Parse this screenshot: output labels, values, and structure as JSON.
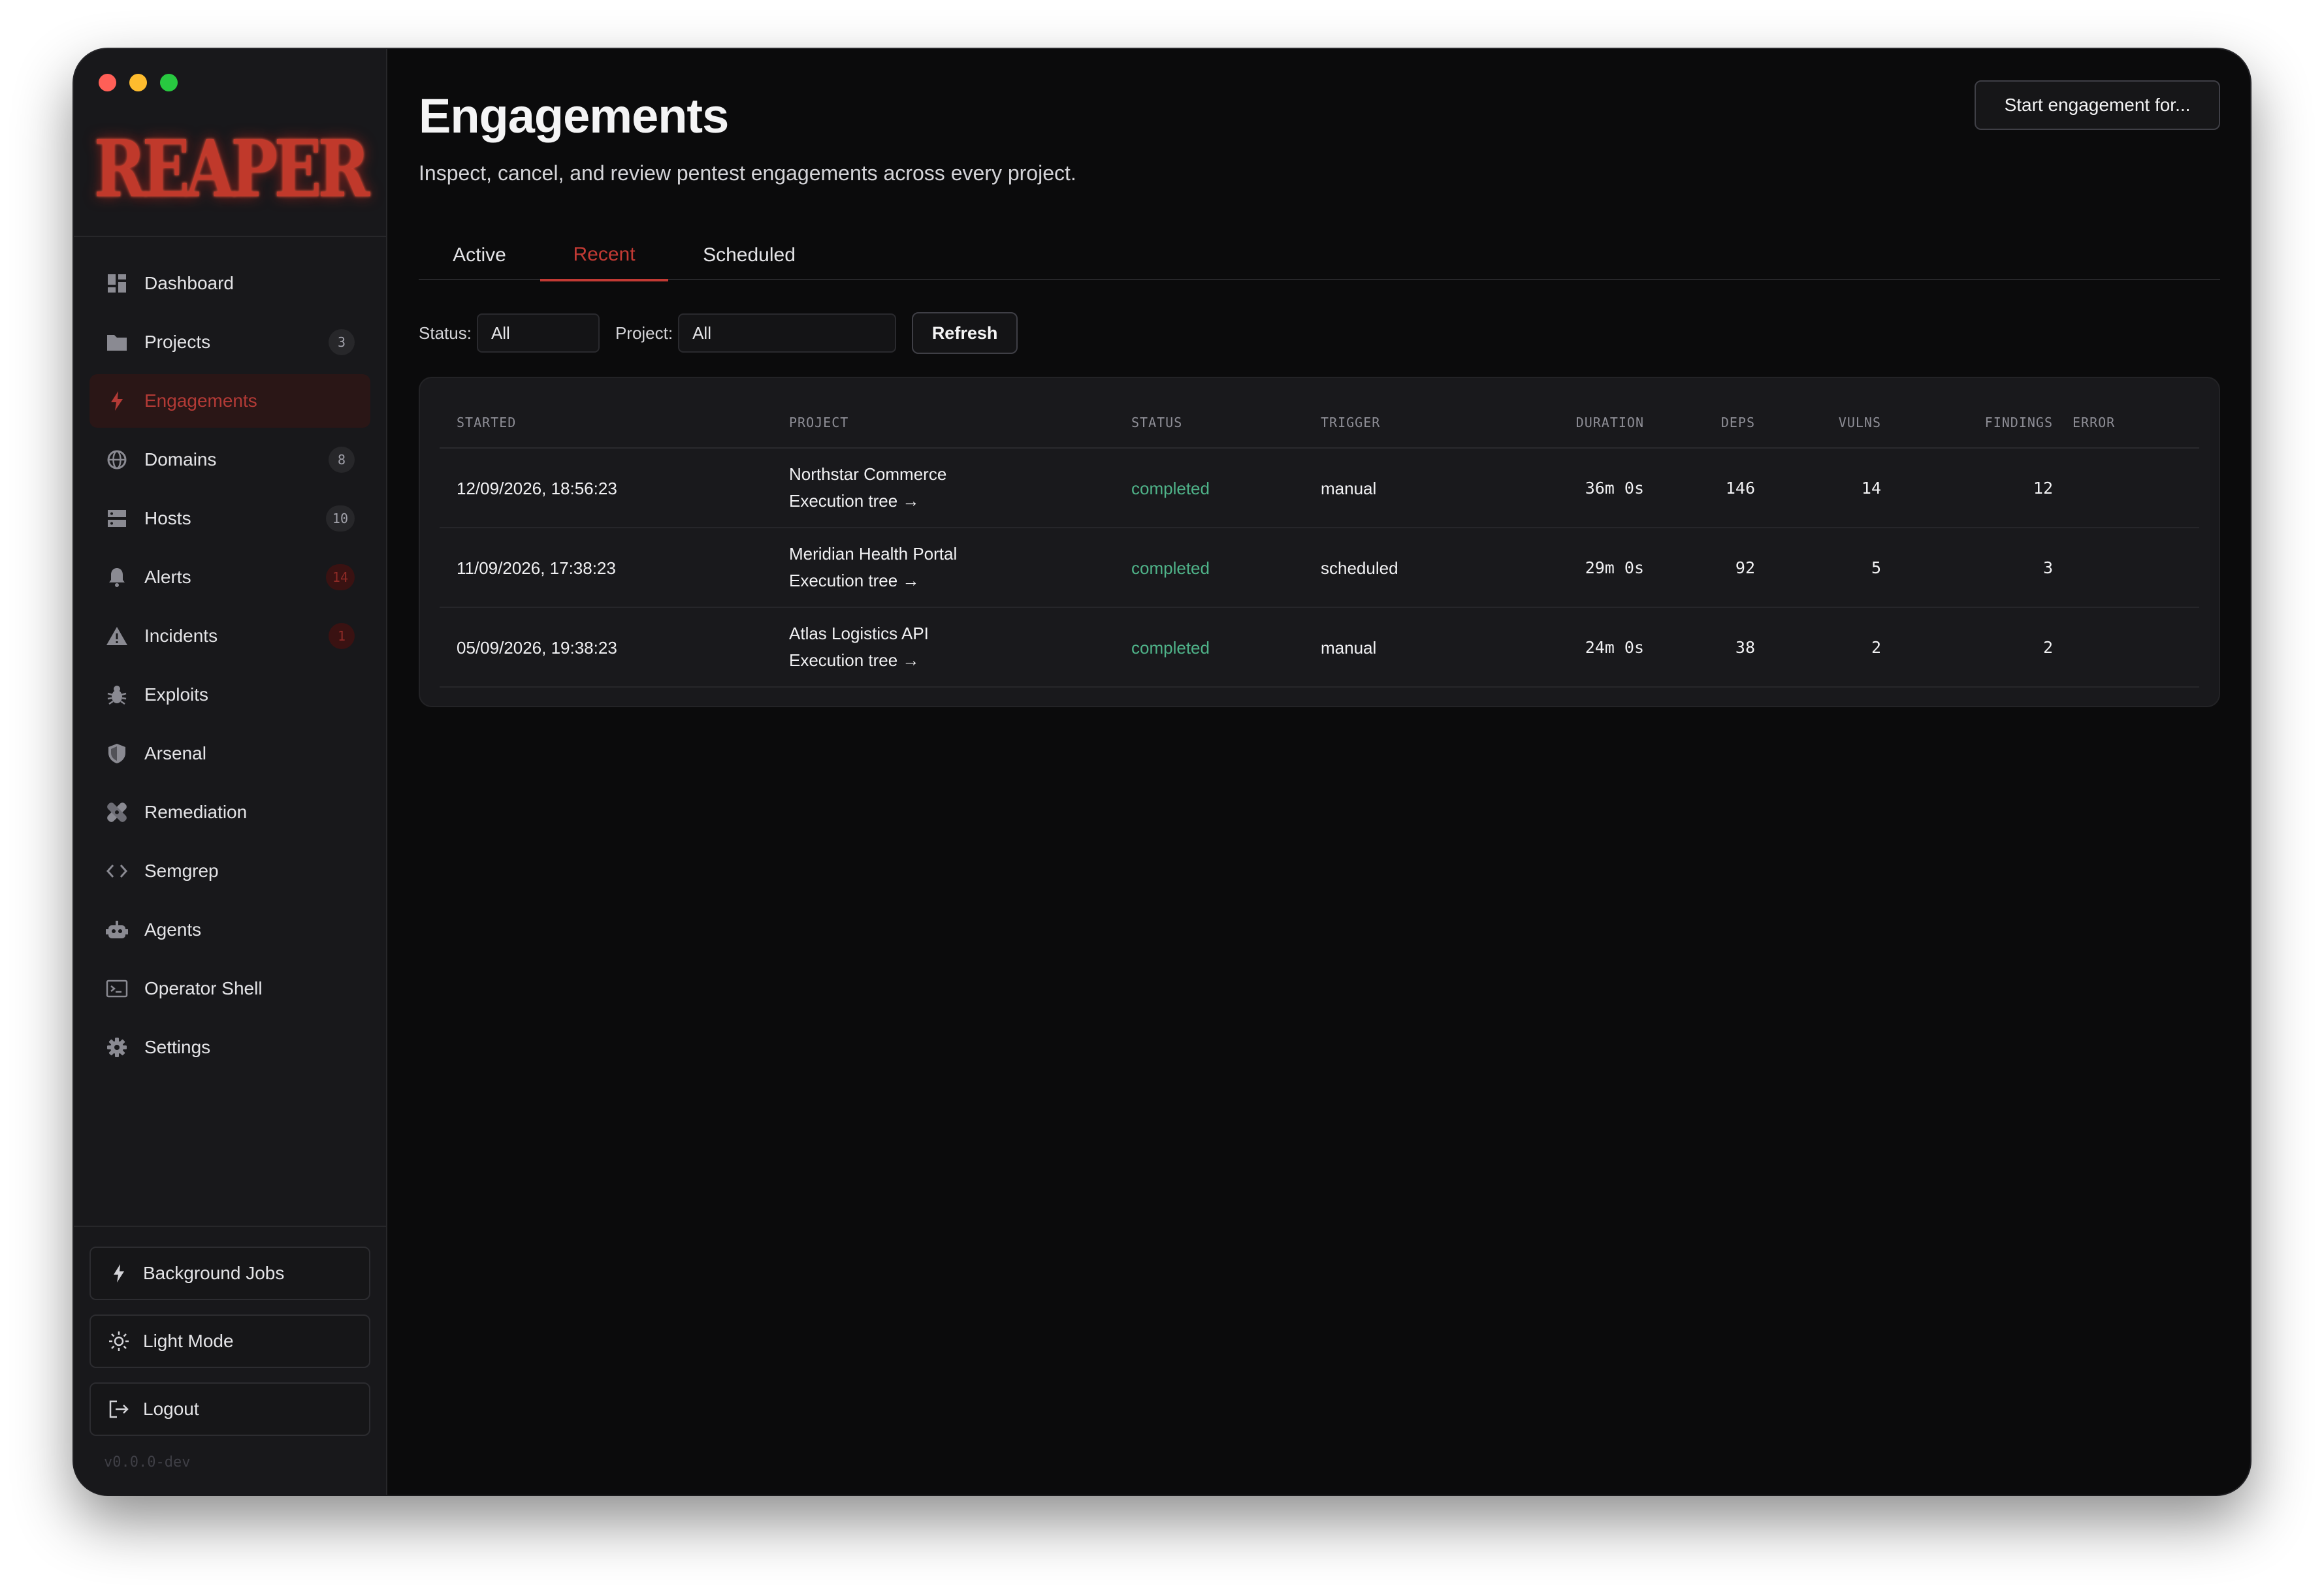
{
  "sidebar": {
    "logo_text": "REAPER",
    "items": [
      {
        "label": "Dashboard",
        "icon": "dashboard-icon",
        "badge": ""
      },
      {
        "label": "Projects",
        "icon": "folder-icon",
        "badge": "3"
      },
      {
        "label": "Engagements",
        "icon": "bolt-icon",
        "badge": "",
        "active": true
      },
      {
        "label": "Domains",
        "icon": "globe-icon",
        "badge": "8"
      },
      {
        "label": "Hosts",
        "icon": "server-icon",
        "badge": "10"
      },
      {
        "label": "Alerts",
        "icon": "bell-icon",
        "badge": "14"
      },
      {
        "label": "Incidents",
        "icon": "warning-icon",
        "badge": "1"
      },
      {
        "label": "Exploits",
        "icon": "bug-icon",
        "badge": ""
      },
      {
        "label": "Arsenal",
        "icon": "shield-icon",
        "badge": ""
      },
      {
        "label": "Remediation",
        "icon": "bandage-icon",
        "badge": ""
      },
      {
        "label": "Semgrep",
        "icon": "code-icon",
        "badge": ""
      },
      {
        "label": "Agents",
        "icon": "robot-icon",
        "badge": ""
      },
      {
        "label": "Operator Shell",
        "icon": "terminal-icon",
        "badge": ""
      },
      {
        "label": "Settings",
        "icon": "gear-icon",
        "badge": ""
      }
    ],
    "background_jobs_label": "Background Jobs",
    "light_mode_label": "Light Mode",
    "logout_label": "Logout",
    "version": "v0.0.0-dev"
  },
  "header": {
    "title": "Engagements",
    "subtitle": "Inspect, cancel, and review pentest engagements across every project.",
    "start_button_label": "Start engagement for..."
  },
  "tabs": [
    {
      "label": "Active",
      "active": false
    },
    {
      "label": "Recent",
      "active": true
    },
    {
      "label": "Scheduled",
      "active": false
    }
  ],
  "filters": {
    "status_label": "Status:",
    "status_value": "All",
    "project_label": "Project:",
    "project_value": "All",
    "refresh_label": "Refresh"
  },
  "table": {
    "columns": [
      "STARTED",
      "PROJECT",
      "STATUS",
      "TRIGGER",
      "DURATION",
      "DEPS",
      "VULNS",
      "FINDINGS",
      "ERROR"
    ],
    "rows": [
      {
        "started": "12/09/2026, 18:56:23",
        "project": "Northstar Commerce",
        "link": "Execution tree →",
        "status": "completed",
        "trigger": "manual",
        "duration": "36m 0s",
        "deps": "146",
        "vulns": "14",
        "findings": "12",
        "error": ""
      },
      {
        "started": "11/09/2026, 17:38:23",
        "project": "Meridian Health Portal",
        "link": "Execution tree →",
        "status": "completed",
        "trigger": "scheduled",
        "duration": "29m 0s",
        "deps": "92",
        "vulns": "5",
        "findings": "3",
        "error": ""
      },
      {
        "started": "05/09/2026, 19:38:23",
        "project": "Atlas Logistics API",
        "link": "Execution tree →",
        "status": "completed",
        "trigger": "manual",
        "duration": "24m 0s",
        "deps": "38",
        "vulns": "2",
        "findings": "2",
        "error": ""
      }
    ]
  },
  "colors": {
    "accent": "#c23a34",
    "status_completed": "#4fb389",
    "background": "#0b0b0c",
    "sidebar": "#18181b"
  }
}
